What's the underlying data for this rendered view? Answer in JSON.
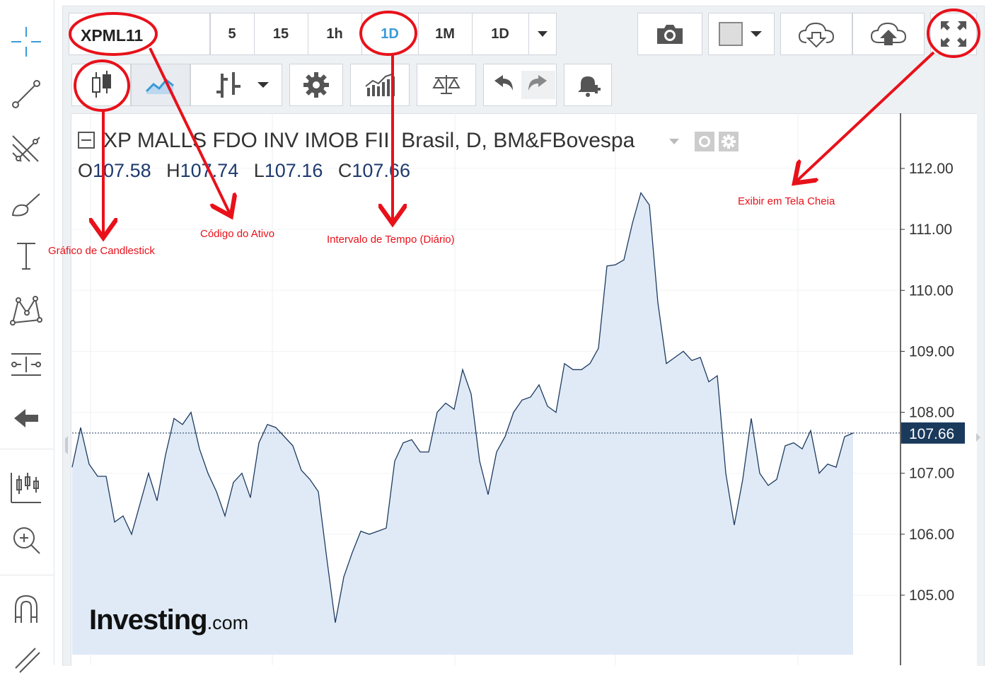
{
  "toolbar": {
    "symbol": "XPML11",
    "intervals": [
      "5",
      "15",
      "1h",
      "1D",
      "1M",
      "1D"
    ],
    "active_interval_index": 3
  },
  "chart_header": {
    "title": "XP MALLS FDO INV IMOB FII, Brasil, D, BM&FBovespa",
    "ohlc": {
      "o_label": "O",
      "o": "107.58",
      "h_label": "H",
      "h": "107.74",
      "l_label": "L",
      "l": "107.16",
      "c_label": "C",
      "c": "107.66"
    }
  },
  "annotations": {
    "candlestick": "Gráfico de Candlestick",
    "symbol_code": "Código do Ativo",
    "interval": "Intervalo de Tempo (Diário)",
    "fullscreen": "Exibir em Tela Cheia"
  },
  "logo": {
    "main": "Investing",
    "suffix": ".com"
  },
  "colors": {
    "line": "#1e3a5f",
    "area": "#dfeaf6",
    "annotation": "#e8111a",
    "active_interval": "#3a9bd8",
    "last_price_bg": "#1a3a5c"
  },
  "chart_data": {
    "type": "area",
    "ylim": [
      104.0,
      112.6
    ],
    "y_ticks": [
      "112.00",
      "111.00",
      "110.00",
      "109.00",
      "108.00",
      "107.00",
      "106.00",
      "105.00"
    ],
    "y_tick_values": [
      112,
      111,
      110,
      109,
      108,
      107,
      106,
      105
    ],
    "last_price_label": "107.66",
    "last_price": 107.66,
    "values": [
      107.1,
      107.75,
      107.15,
      106.95,
      106.95,
      106.2,
      106.3,
      106.0,
      106.5,
      107.0,
      106.55,
      107.3,
      107.9,
      107.8,
      108.0,
      107.4,
      107.0,
      106.7,
      106.3,
      106.85,
      107.0,
      106.6,
      107.5,
      107.8,
      107.75,
      107.6,
      107.45,
      107.05,
      106.9,
      106.7,
      105.6,
      104.55,
      105.3,
      105.7,
      106.05,
      106.0,
      106.05,
      106.1,
      107.2,
      107.5,
      107.55,
      107.35,
      107.35,
      108.0,
      108.15,
      108.05,
      108.7,
      108.3,
      107.2,
      106.65,
      107.35,
      107.6,
      108.0,
      108.2,
      108.25,
      108.45,
      108.1,
      108.0,
      108.8,
      108.7,
      108.7,
      108.8,
      109.05,
      110.4,
      110.42,
      110.5,
      111.1,
      111.6,
      111.4,
      109.8,
      108.8,
      108.9,
      109.0,
      108.85,
      108.9,
      108.5,
      108.6,
      107.0,
      106.15,
      106.9,
      107.9,
      107.0,
      106.8,
      106.9,
      107.45,
      107.5,
      107.4,
      107.7,
      107.0,
      107.15,
      107.1,
      107.6,
      107.66
    ]
  }
}
